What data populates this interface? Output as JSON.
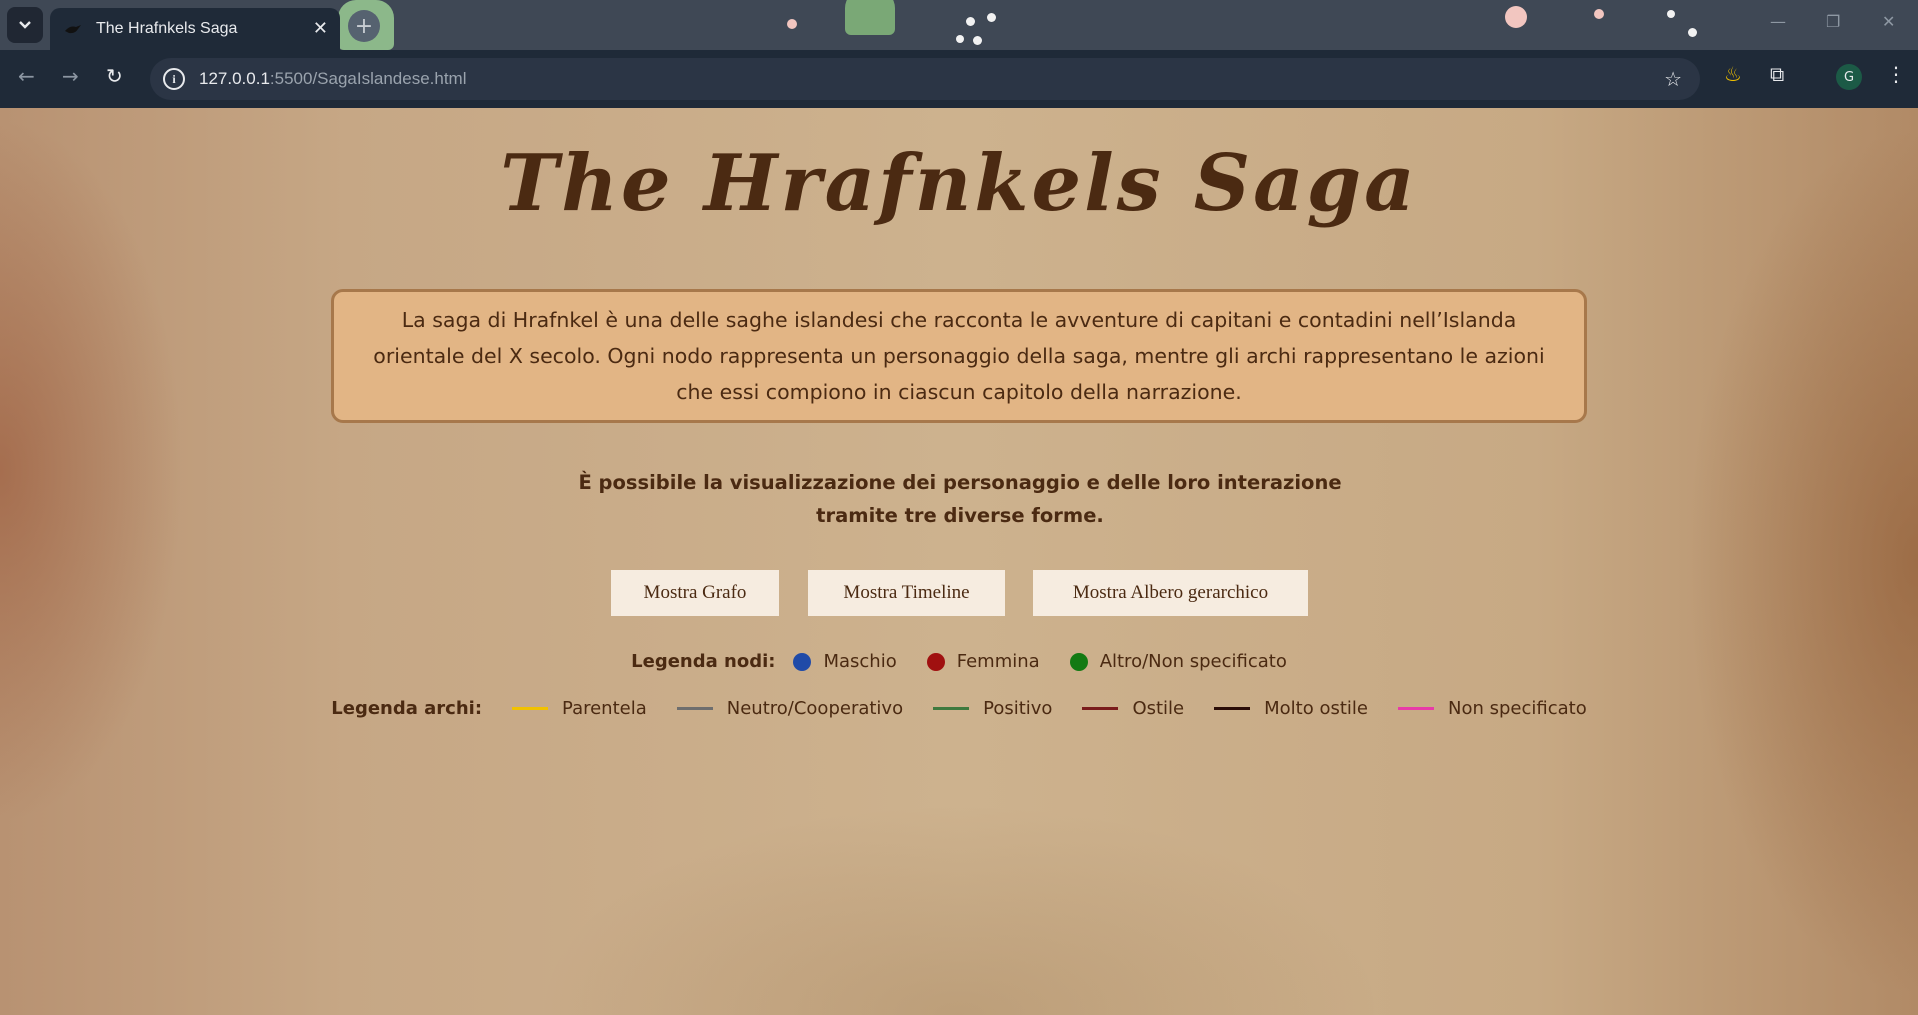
{
  "browser": {
    "tab_title": "The Hrafnkels Saga",
    "url_host": "127.0.0.1",
    "url_path": ":5500/SagaIslandese.html",
    "profile_initial": "G"
  },
  "page": {
    "title": "The Hrafnkels Saga",
    "description": "La saga di Hrafnkel è una delle saghe islandesi che racconta le avventure di capitani e contadini nell’Islanda orientale del X secolo. Ogni nodo rappresenta un personaggio della saga, mentre gli archi rappresentano le azioni che essi compiono in ciascun capitolo della narrazione.",
    "subtitle_line1": "È possibile la visualizzazione dei personaggio e delle loro interazione",
    "subtitle_line2": "tramite tre diverse forme.",
    "buttons": {
      "graph": "Mostra Grafo",
      "timeline": "Mostra Timeline",
      "tree": "Mostra Albero gerarchico"
    },
    "node_legend": {
      "label": "Legenda nodi:",
      "items": [
        {
          "label": "Maschio",
          "color": "#1f4aa8"
        },
        {
          "label": "Femmina",
          "color": "#a01010"
        },
        {
          "label": "Altro/Non specificato",
          "color": "#137a13"
        }
      ]
    },
    "edge_legend": {
      "label": "Legenda archi:",
      "items": [
        {
          "label": "Parentela",
          "color": "#f2c200"
        },
        {
          "label": "Neutro/Cooperativo",
          "color": "#6e6e6e"
        },
        {
          "label": "Positivo",
          "color": "#3f7a3f"
        },
        {
          "label": "Ostile",
          "color": "#7a1c1c"
        },
        {
          "label": "Molto ostile",
          "color": "#2a0d08"
        },
        {
          "label": "Non specificato",
          "color": "#e83aa8"
        }
      ]
    }
  }
}
